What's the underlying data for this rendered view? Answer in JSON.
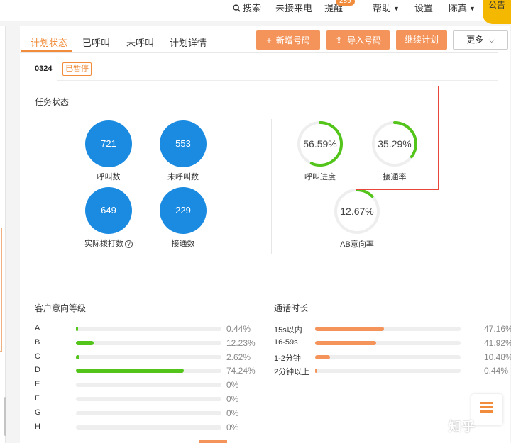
{
  "topbar": {
    "search_label": "搜索",
    "missed_calls_label": "未接来电",
    "reminder_label": "提醒",
    "reminder_count": "289",
    "help_label": "帮助",
    "settings_label": "设置",
    "user_name": "陈真",
    "notice_label": "公告"
  },
  "tabs": [
    "计划状态",
    "已呼叫",
    "未呼叫",
    "计划详情"
  ],
  "actions": {
    "add_number": "新增号码",
    "import_number": "导入号码",
    "continue_plan": "继续计划",
    "more": "更多"
  },
  "plan": {
    "code": "0324",
    "status": "已暂停"
  },
  "task_status": {
    "title": "任务状态",
    "stats": [
      {
        "value": "721",
        "label": "呼叫数"
      },
      {
        "value": "553",
        "label": "未呼叫数"
      },
      {
        "value": "649",
        "label": "实际拨打数"
      },
      {
        "value": "229",
        "label": "接通数"
      }
    ],
    "rates": [
      {
        "value": "56.59%",
        "label": "呼叫进度",
        "fraction": 0.5659
      },
      {
        "value": "35.29%",
        "label": "接通率",
        "fraction": 0.3529
      },
      {
        "value": "12.67%",
        "label": "AB意向率",
        "fraction": 0.1267
      }
    ]
  },
  "intent_levels": {
    "title": "客户意向等级",
    "rows": [
      {
        "label": "A",
        "pct": "0.44%",
        "value": 0.44
      },
      {
        "label": "B",
        "pct": "12.23%",
        "value": 12.23
      },
      {
        "label": "C",
        "pct": "2.62%",
        "value": 2.62
      },
      {
        "label": "D",
        "pct": "74.24%",
        "value": 74.24
      },
      {
        "label": "E",
        "pct": "0%",
        "value": 0
      },
      {
        "label": "F",
        "pct": "0%",
        "value": 0
      },
      {
        "label": "G",
        "pct": "0%",
        "value": 0
      },
      {
        "label": "H",
        "pct": "0%",
        "value": 0
      }
    ]
  },
  "call_duration": {
    "title": "通话时长",
    "rows": [
      {
        "label": "15s以内",
        "pct": "47.16%",
        "value": 47.16
      },
      {
        "label": "16-59s",
        "pct": "41.92%",
        "value": 41.92
      },
      {
        "label": "1-2分钟",
        "pct": "10.48%",
        "value": 10.48
      },
      {
        "label": "2分钟以上",
        "pct": "0.44%",
        "value": 0.44
      }
    ]
  },
  "colors": {
    "accent": "#f08c3b",
    "button": "#f5945a",
    "stat_circle": "#1a8be0",
    "green": "#52c41a",
    "orange_bar": "#f5945a",
    "highlight": "#e8463b"
  },
  "watermark": "知乎"
}
